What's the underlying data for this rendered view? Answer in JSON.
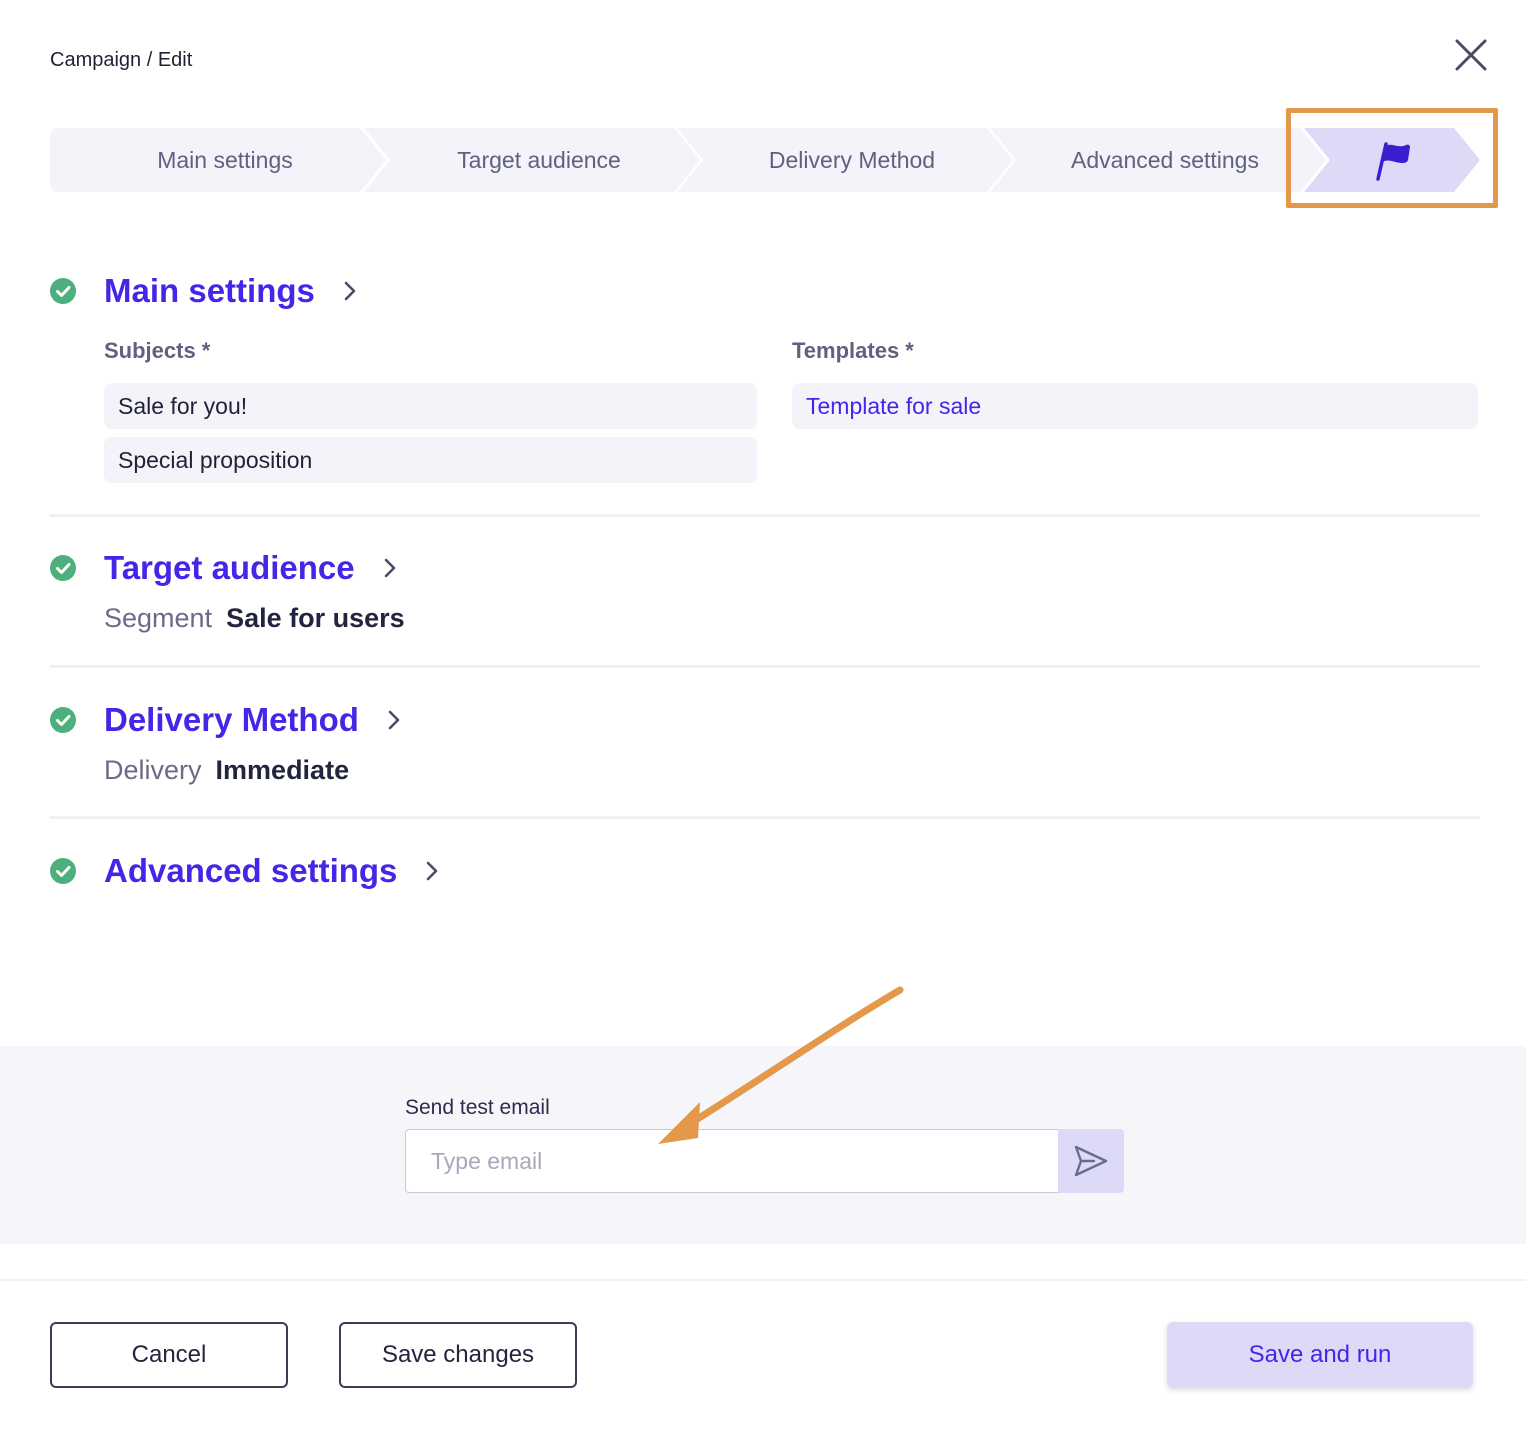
{
  "breadcrumb": "Campaign / Edit",
  "stepper": {
    "steps": [
      "Main settings",
      "Target audience",
      "Delivery Method",
      "Advanced settings"
    ],
    "final_icon": "flag-icon"
  },
  "sections": {
    "main": {
      "title": "Main settings",
      "subjects_label": "Subjects *",
      "subjects": [
        "Sale for you!",
        "Special proposition"
      ],
      "templates_label": "Templates *",
      "template": "Template for sale"
    },
    "audience": {
      "title": "Target audience",
      "key": "Segment",
      "value": "Sale for users"
    },
    "delivery": {
      "title": "Delivery Method",
      "key": "Delivery",
      "value": "Immediate"
    },
    "advanced": {
      "title": "Advanced settings"
    }
  },
  "test_email": {
    "label": "Send test email",
    "placeholder": "Type email",
    "value": ""
  },
  "footer": {
    "cancel": "Cancel",
    "save": "Save changes",
    "run": "Save and run"
  },
  "colors": {
    "accent": "#4526e8",
    "success": "#4caf7d",
    "highlight": "#e3984a",
    "accent_soft": "#dcdaf7"
  }
}
